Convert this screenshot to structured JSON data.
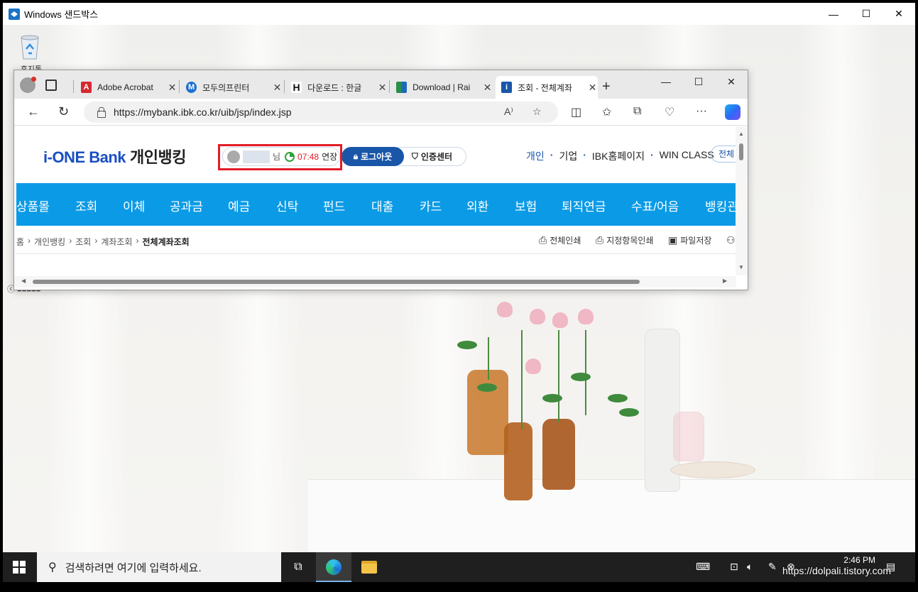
{
  "sandbox": {
    "title": "Windows 샌드박스",
    "minimize": "—",
    "maximize": "☐",
    "close": "✕"
  },
  "desktop": {
    "recycle_label": "휴지통",
    "leftover_label": "ⓒ ■■■■■"
  },
  "browser": {
    "tabs": [
      {
        "label": "Adobe Acrobat",
        "favicon": "adobe-icon",
        "color": "#d7282f"
      },
      {
        "label": "모두의프린터",
        "favicon": "modu-icon",
        "color": "#1b6fd0"
      },
      {
        "label": "다운로드 : 한글",
        "favicon": "hancom-icon",
        "color": "#111111"
      },
      {
        "label": "Download | Rai",
        "favicon": "rai-icon",
        "color": "#2a8f4a"
      },
      {
        "label": "조회 - 전체계좌",
        "favicon": "ibk-icon",
        "color": "#1a56a8"
      }
    ],
    "new_tab": "+",
    "url": "https://mybank.ibk.co.kr/uib/jsp/index.jsp",
    "window_controls": {
      "minimize": "—",
      "maximize": "☐",
      "close": "✕"
    }
  },
  "site": {
    "logo_en": "i-ONE Bank",
    "logo_ko": "개인뱅킹",
    "user_suffix": "님",
    "timer": "07:48",
    "extend": "연장",
    "logout": "로그아웃",
    "cert_center": "인증센터",
    "top_links": [
      "개인",
      "기업",
      "IBK홈페이지",
      "WIN CLASS"
    ],
    "all_menu": "전체",
    "gnb": [
      "상품몰",
      "조회",
      "이체",
      "공과금",
      "예금",
      "신탁",
      "펀드",
      "대출",
      "카드",
      "외환",
      "보험",
      "퇴직연금",
      "수표/어음",
      "뱅킹관"
    ],
    "breadcrumb": [
      "홈",
      "개인뱅킹",
      "조회",
      "계좌조회",
      "전체계좌조회"
    ],
    "utils": [
      "전체인쇄",
      "지정항목인쇄",
      "파일저장"
    ],
    "accent": "#0b9be6",
    "highlight": "#e31c25"
  },
  "taskbar": {
    "search_placeholder": "검색하려면 여기에 입력하세요.",
    "time": "2:46 PM",
    "watermark": "https://dolpali.tistory.com"
  }
}
